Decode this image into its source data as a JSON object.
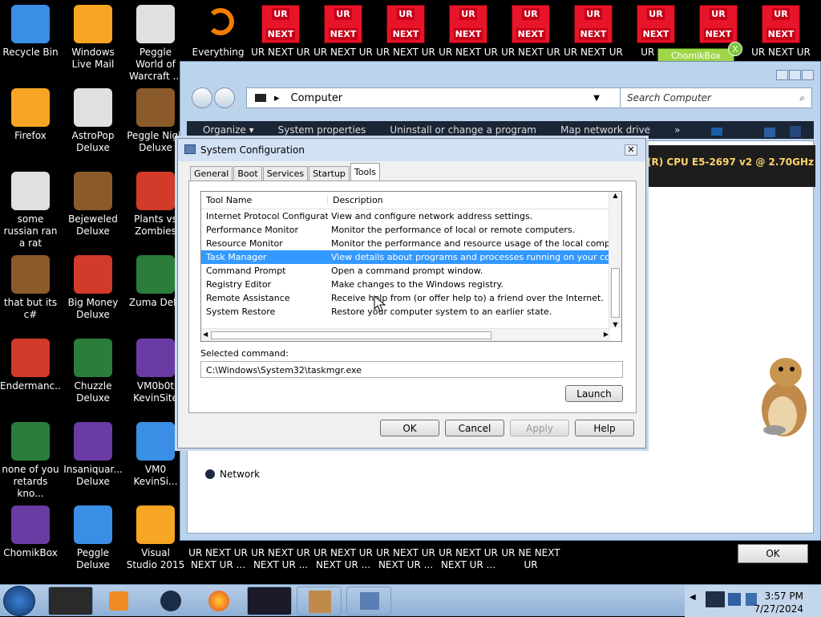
{
  "desktop": {
    "icons_left": [
      {
        "label": "Recycle Bin",
        "icon": "trash-can-icon"
      },
      {
        "label": "Firefox",
        "icon": "firefox-icon"
      },
      {
        "label": "some russian ran a rat",
        "icon": "app-icon"
      },
      {
        "label": "that but its c#",
        "icon": "stack-icon"
      },
      {
        "label": "Endermanc...",
        "icon": "monitor-icon"
      },
      {
        "label": "none of you retards kno...",
        "icon": "app-icon"
      },
      {
        "label": "ChomikBox",
        "icon": "hamster-icon"
      }
    ],
    "icons_col2": [
      {
        "label": "Windows Live Mail",
        "icon": "mail-icon"
      },
      {
        "label": "AstroPop Deluxe",
        "icon": "game-icon"
      },
      {
        "label": "Bejeweled Deluxe",
        "icon": "gem-icon"
      },
      {
        "label": "Big Money Deluxe",
        "icon": "game-icon"
      },
      {
        "label": "Chuzzle Deluxe",
        "icon": "game-icon"
      },
      {
        "label": "Insaniquar... Deluxe",
        "icon": "fish-icon"
      },
      {
        "label": "Peggle Deluxe",
        "icon": "peggle-icon"
      }
    ],
    "icons_col3": [
      {
        "label": "Peggle World of Warcraft ...",
        "icon": "peggle-icon"
      },
      {
        "label": "Peggle Nigh Deluxe",
        "icon": "peggle-icon"
      },
      {
        "label": "Plants vs Zombies",
        "icon": "plant-icon"
      },
      {
        "label": "Zuma Delu",
        "icon": "zuma-icon"
      },
      {
        "label": "VM0b0t KevinSite",
        "icon": "vm-icon"
      },
      {
        "label": "VM0 KevinSi...",
        "icon": "vm-icon"
      },
      {
        "label": "Visual Studio 2015",
        "icon": "visual-studio-icon"
      }
    ],
    "everything_label": "Everything",
    "ur_top": [
      {
        "badge_top": "UR",
        "badge_bottom": "NEXT",
        "label": "UR NEXT UR"
      },
      {
        "badge_top": "UR",
        "badge_bottom": "NEXT",
        "label": "UR NEXT UR"
      },
      {
        "badge_top": "UR",
        "badge_bottom": "NEXT",
        "label": "UR NEXT UR"
      },
      {
        "badge_top": "UR",
        "badge_bottom": "NEXT",
        "label": "UR NEXT UR"
      },
      {
        "badge_top": "UR",
        "badge_bottom": "NEXT",
        "label": "UR NEXT UR"
      },
      {
        "badge_top": "UR",
        "badge_bottom": "NEXT",
        "label": "UR NEXT UR"
      },
      {
        "badge_top": "UR",
        "badge_bottom": "NEXT",
        "label": "UR NE"
      },
      {
        "badge_top": "UR",
        "badge_bottom": "NEXT",
        "label": "UR"
      },
      {
        "badge_top": "UR",
        "badge_bottom": "NEXT",
        "label": "UR NEXT UR"
      }
    ],
    "ur_bottom": [
      {
        "label": "UR NEXT UR NEXT UR ..."
      },
      {
        "label": "UR NEXT UR NEXT UR ..."
      },
      {
        "label": "UR NEXT UR NEXT UR ..."
      },
      {
        "label": "UR NEXT UR NEXT UR ..."
      },
      {
        "label": "UR NEXT UR NEXT UR ..."
      },
      {
        "label": "UR NE NEXT UR"
      }
    ],
    "chomik_bubble": "ChomikBox"
  },
  "explorer": {
    "address": "Computer",
    "search_placeholder": "Search Computer",
    "toolbar": [
      "Organize ▾",
      "System properties",
      "Uninstall or change a program",
      "Map network drive",
      "»"
    ],
    "cpu_text": "(R) CPU E5-2697 v2 @ 2.70GHz",
    "network_label": "Network",
    "ok_label": "OK"
  },
  "dialog": {
    "title": "System Configuration",
    "tabs": [
      "General",
      "Boot",
      "Services",
      "Startup",
      "Tools"
    ],
    "active_tab": "Tools",
    "col_tool": "Tool Name",
    "col_desc": "Description",
    "rows": [
      {
        "name": "Internet Protocol Configurat...",
        "desc": "View and configure network address settings."
      },
      {
        "name": "Performance Monitor",
        "desc": "Monitor the performance of local or remote computers."
      },
      {
        "name": "Resource Monitor",
        "desc": "Monitor the performance and resource usage of the local computer."
      },
      {
        "name": "Task Manager",
        "desc": "View details about programs and processes running on your computer."
      },
      {
        "name": "Command Prompt",
        "desc": "Open a command prompt window."
      },
      {
        "name": "Registry Editor",
        "desc": "Make changes to the Windows registry."
      },
      {
        "name": "Remote Assistance",
        "desc": "Receive help from (or offer help to) a friend over the Internet."
      },
      {
        "name": "System Restore",
        "desc": "Restore your computer system to an earlier state."
      }
    ],
    "selected_index": 3,
    "selected_command_label": "Selected command:",
    "selected_command": "C:\\Windows\\System32\\taskmgr.exe",
    "launch": "Launch",
    "ok": "OK",
    "cancel": "Cancel",
    "apply": "Apply",
    "help": "Help"
  },
  "taskbar": {
    "time": "3:57 PM",
    "date": "7/27/2024"
  }
}
